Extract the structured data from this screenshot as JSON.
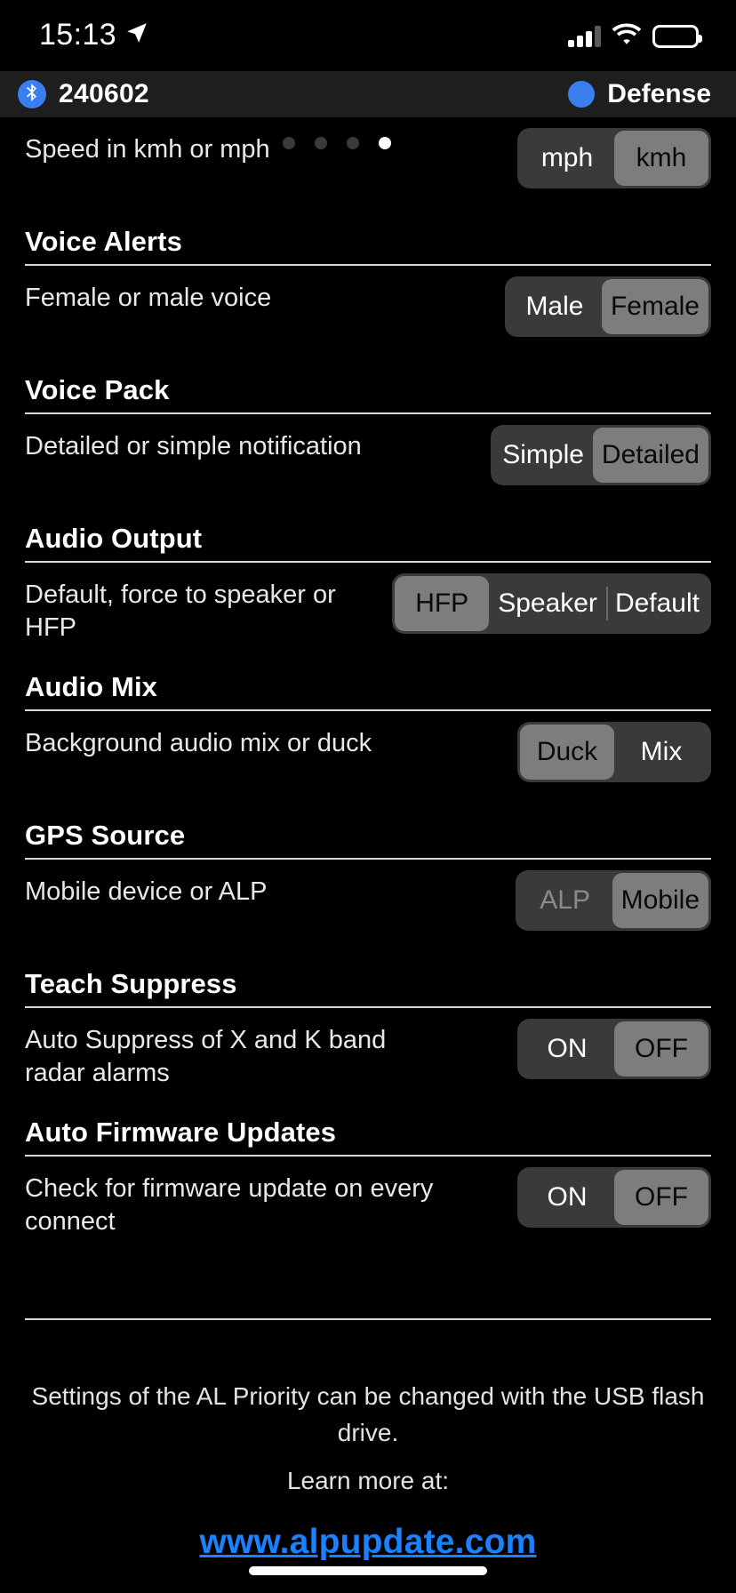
{
  "status_bar": {
    "time": "15:13",
    "location_icon": "location-arrow-icon",
    "signal_icon": "cellular-signal-icon",
    "wifi_icon": "wifi-icon",
    "battery_icon": "battery-full-icon"
  },
  "header": {
    "bluetooth_icon": "bluetooth-icon",
    "device_name": "240602",
    "mode_dot_color": "#3b7ef0",
    "mode_label": "Defense"
  },
  "page_dots": {
    "count": 4,
    "active_index": 3
  },
  "settings": [
    {
      "section_title": null,
      "description": "Speed in kmh or mph",
      "options": [
        "mph",
        "kmh"
      ],
      "selected": "kmh",
      "disabled": []
    },
    {
      "section_title": "Voice Alerts",
      "description": "Female or male voice",
      "options": [
        "Male",
        "Female"
      ],
      "selected": "Female",
      "disabled": []
    },
    {
      "section_title": "Voice Pack",
      "description": "Detailed or simple notification",
      "options": [
        "Simple",
        "Detailed"
      ],
      "selected": "Detailed",
      "disabled": []
    },
    {
      "section_title": "Audio Output",
      "description": "Default, force to speaker or HFP",
      "options": [
        "HFP",
        "Speaker",
        "Default"
      ],
      "selected": "HFP",
      "disabled": []
    },
    {
      "section_title": "Audio Mix",
      "description": "Background audio mix or duck",
      "options": [
        "Duck",
        "Mix"
      ],
      "selected": "Duck",
      "disabled": []
    },
    {
      "section_title": "GPS Source",
      "description": "Mobile device or ALP",
      "options": [
        "ALP",
        "Mobile"
      ],
      "selected": "Mobile",
      "disabled": [
        "ALP"
      ]
    },
    {
      "section_title": "Teach Suppress",
      "description": "Auto Suppress of X and K band radar alarms",
      "options": [
        "ON",
        "OFF"
      ],
      "selected": "OFF",
      "disabled": []
    },
    {
      "section_title": "Auto Firmware Updates",
      "description": "Check for firmware update on every connect",
      "options": [
        "ON",
        "OFF"
      ],
      "selected": "OFF",
      "disabled": []
    }
  ],
  "footer": {
    "line1": "Settings of the AL Priority can be changed with the USB flash drive.",
    "line2": "Learn more at:",
    "link": "www.alpupdate.com",
    "link_color": "#1a82ff"
  },
  "colors": {
    "background": "#000000",
    "header_background": "#1e1e1e",
    "segment_track": "#3a3a3c",
    "segment_selected": "#7d7d80",
    "accent_blue": "#3b7ef0",
    "rule": "#d8d8d8"
  }
}
